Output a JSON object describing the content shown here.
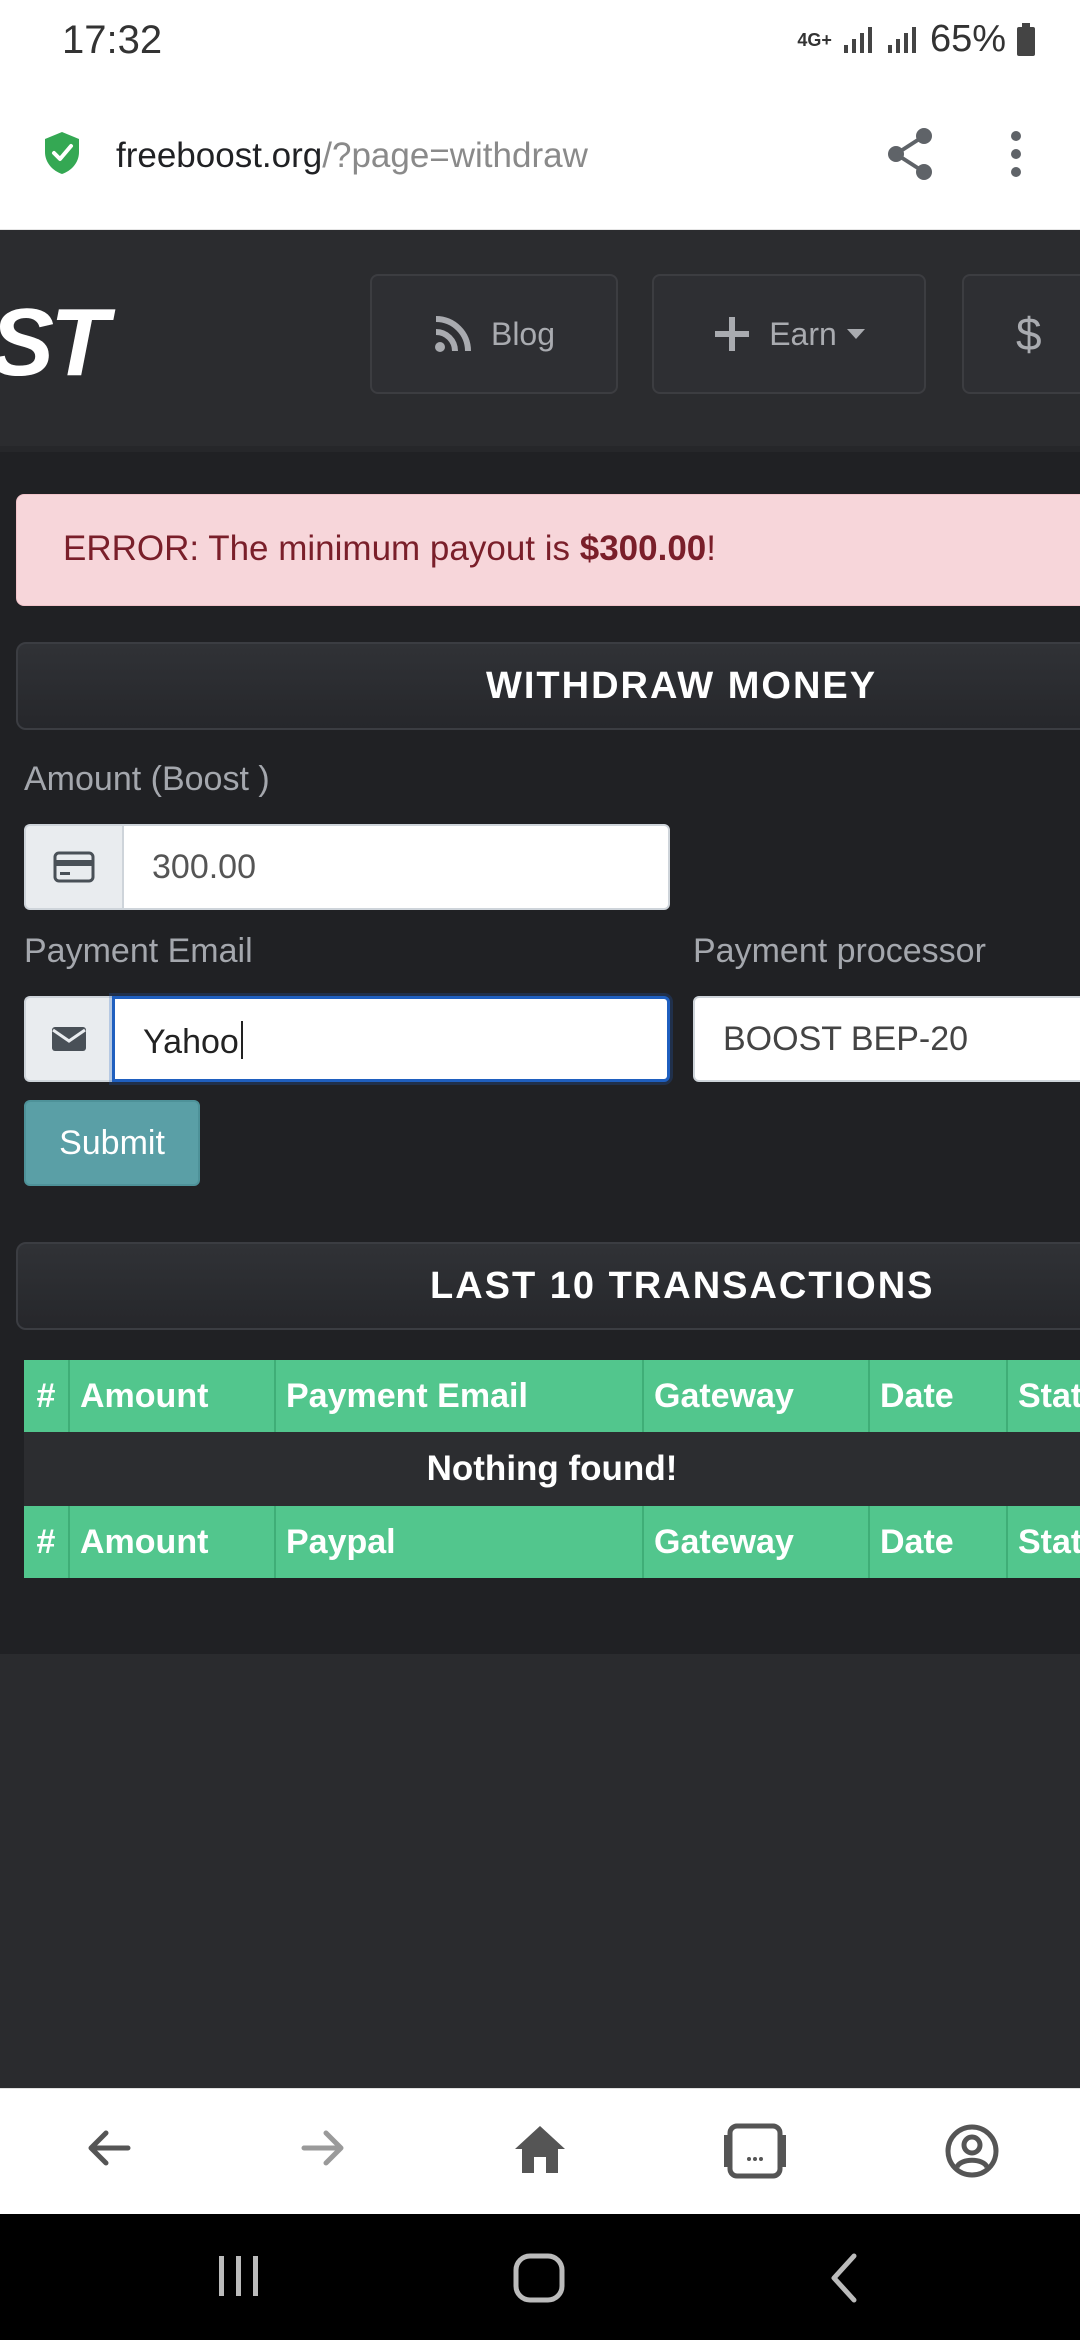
{
  "status_bar": {
    "time": "17:32",
    "network": "4G+",
    "battery": "65%"
  },
  "browser": {
    "url_domain": "freeboost.org",
    "url_path": "/?page=withdraw"
  },
  "header": {
    "logo_text": "ST",
    "nav": [
      {
        "label": "Blog",
        "icon": "rss-icon"
      },
      {
        "label": "Earn",
        "icon": "plus-icon"
      },
      {
        "label": "$",
        "icon": "dollar-icon"
      }
    ]
  },
  "alert": {
    "prefix": "ERROR: The minimum payout is ",
    "amount": "$300.00",
    "suffix": "!"
  },
  "withdraw": {
    "title": "WITHDRAW MONEY",
    "amount_label": "Amount (Boost )",
    "amount_value": "300.00",
    "email_label": "Payment Email",
    "email_value": "Yahoo",
    "processor_label": "Payment processor",
    "processor_value": "BOOST BEP-20",
    "submit_label": "Submit"
  },
  "transactions": {
    "title": "LAST 10 TRANSACTIONS",
    "header_columns": [
      "#",
      "Amount",
      "Payment Email",
      "Gateway",
      "Date",
      "Stat"
    ],
    "empty_message": "Nothing found!",
    "footer_columns": [
      "#",
      "Amount",
      "Paypal",
      "Gateway",
      "Date",
      "Stat"
    ]
  },
  "colors": {
    "accent_green": "#52c68d",
    "submit_teal": "#5a9fa6",
    "alert_bg": "#f7d6da",
    "alert_text": "#7a1f2a",
    "page_bg": "#202124"
  }
}
